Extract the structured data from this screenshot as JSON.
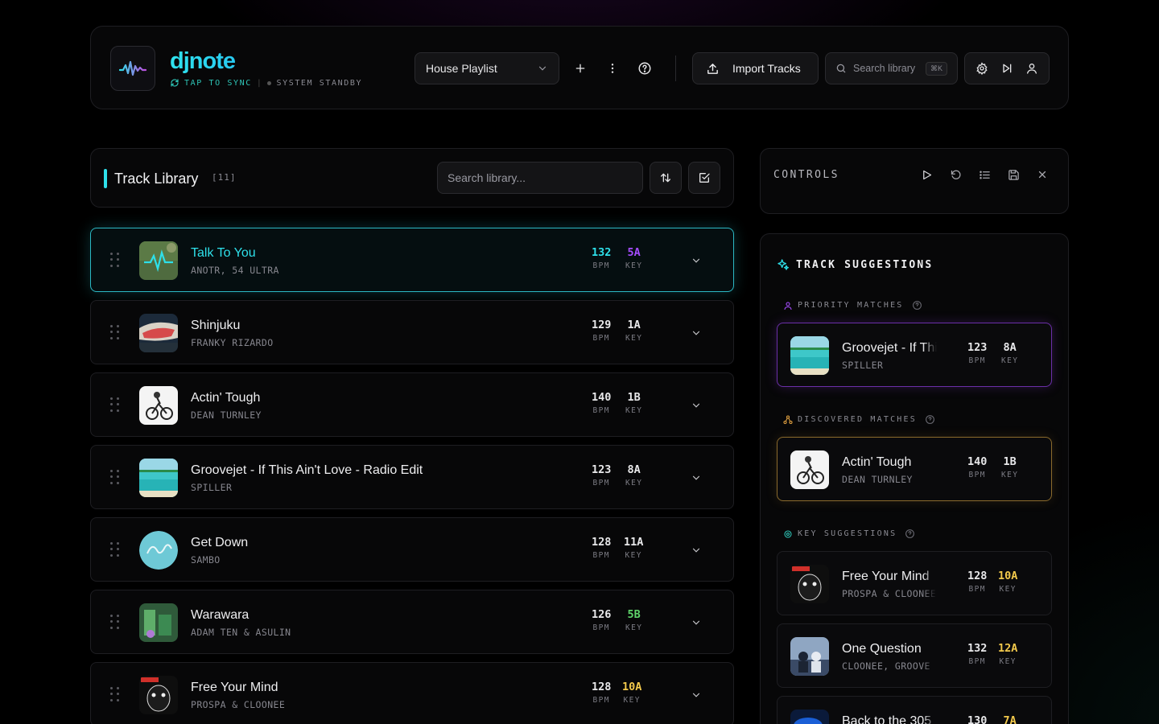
{
  "app": {
    "name": "djnote",
    "sync_label": "TAP TO SYNC",
    "status_label": "SYSTEM STANDBY"
  },
  "header": {
    "playlist": "House Playlist",
    "import_label": "Import Tracks",
    "search_placeholder": "Search library",
    "search_shortcut": "⌘K"
  },
  "library": {
    "title": "Track Library",
    "count": "[11]",
    "search_placeholder": "Search library...",
    "tracks": [
      {
        "title": "Talk To You",
        "artist": "ANOTR, 54 ULTRA",
        "bpm": "132",
        "key": "5A",
        "key_color": "#a64dff",
        "bpm_color": "#2ee0ea",
        "active": true
      },
      {
        "title": "Shinjuku",
        "artist": "FRANKY RIZARDO",
        "bpm": "129",
        "key": "1A",
        "key_color": "#e8e8ea"
      },
      {
        "title": "Actin' Tough",
        "artist": "DEAN TURNLEY",
        "bpm": "140",
        "key": "1B",
        "key_color": "#e8e8ea"
      },
      {
        "title": "Groovejet - If This Ain't Love - Radio Edit",
        "artist": "SPILLER",
        "bpm": "123",
        "key": "8A",
        "key_color": "#e8e8ea"
      },
      {
        "title": "Get Down",
        "artist": "SAMBO",
        "bpm": "128",
        "key": "11A",
        "key_color": "#e8e8ea"
      },
      {
        "title": "Warawara",
        "artist": "ADAM TEN & ASULIN",
        "bpm": "126",
        "key": "5B",
        "key_color": "#5fd46a"
      },
      {
        "title": "Free Your Mind",
        "artist": "PROSPA & CLOONEE",
        "bpm": "128",
        "key": "10A",
        "key_color": "#f2c94c"
      }
    ],
    "bpm_label": "BPM",
    "key_label": "KEY"
  },
  "controls": {
    "title": "CONTROLS"
  },
  "suggestions": {
    "title": "TRACK SUGGESTIONS",
    "priority_label": "PRIORITY MATCHES",
    "discovered_label": "DISCOVERED MATCHES",
    "key_label": "KEY SUGGESTIONS",
    "priority": [
      {
        "title": "Groovejet - If This Ain't Love",
        "artist": "SPILLER",
        "bpm": "123",
        "key": "8A",
        "key_color": "#e8e8ea"
      }
    ],
    "discovered": [
      {
        "title": "Actin' Tough",
        "artist": "DEAN TURNLEY",
        "bpm": "140",
        "key": "1B",
        "key_color": "#e8e8ea"
      }
    ],
    "key_suggestions": [
      {
        "title": "Free Your Mind",
        "artist": "PROSPA & CLOONEE",
        "bpm": "128",
        "key": "10A",
        "key_color": "#f2c94c"
      },
      {
        "title": "One Question",
        "artist": "CLOONEE, GROOVE",
        "bpm": "132",
        "key": "12A",
        "key_color": "#f2c94c"
      },
      {
        "title": "Back to the 305",
        "artist": "",
        "bpm": "130",
        "key": "7A",
        "key_color": "#f2c94c"
      }
    ]
  },
  "colors": {
    "accent": "#2ee0ea",
    "priority": "#6b2fa8",
    "discovered": "#8a6a2c"
  }
}
